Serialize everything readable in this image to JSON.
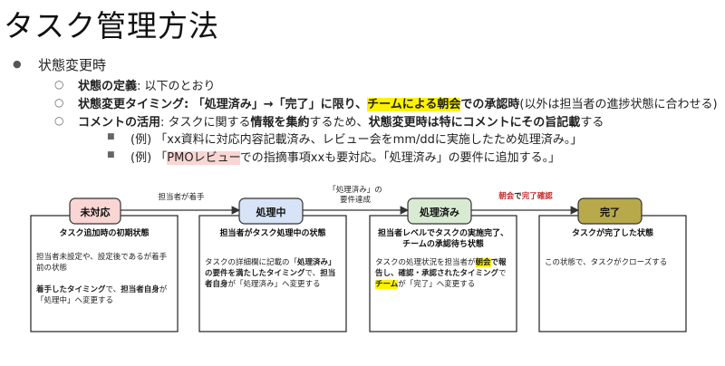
{
  "title": "タスク管理方法",
  "section": {
    "bullet": "●",
    "heading": "状態変更時"
  },
  "items": [
    {
      "bullet": "○",
      "label": "状態の定義",
      "text": ": 以下のとおり"
    },
    {
      "bullet": "○",
      "label": "状態変更タイミング",
      "t1": ": 「処理済み」→「完了」に限り、",
      "hl": "チームによる朝会",
      "t2": "での承認時",
      "t3": "(以外は担当者の進捗状態に合わせる)"
    },
    {
      "bullet": "○",
      "label": "コメントの活用",
      "t1": ": タスクに関する",
      "b1": "情報を集約",
      "t2": "するため、",
      "b2": "状態変更時は特にコメントにその旨記載",
      "t3": "する"
    }
  ],
  "examples": [
    {
      "bullet": "■",
      "text": "(例) 「xx資料に対応内容記載済み、レビュー会をmm/ddに実施したため処理済み。」"
    },
    {
      "bullet": "■",
      "pre": "(例) 「",
      "pink": "PMOレビュー",
      "post": "での指摘事項xxも要対応。「処理済み」の要件に追加する。」"
    }
  ],
  "flow": {
    "stages": [
      {
        "label": "未対応",
        "color": "#f9d5d3"
      },
      {
        "label": "処理中",
        "color": "#d7e3f7"
      },
      {
        "label": "処理済み",
        "color": "#d9ead3"
      },
      {
        "label": "完了",
        "color": "#b8a94a"
      }
    ],
    "arrows": [
      {
        "label": "担当者が着手"
      },
      {
        "label1": "「処理済み」の",
        "label2": "要件達成"
      },
      {
        "red1": "朝会",
        "black": "で",
        "red2": "完了確認"
      }
    ],
    "boxes": [
      {
        "title": "タスク追加時の初期状態",
        "p1": "担当者未設定や、設定後であるが着手前の状態",
        "b1": "着手したタイミング",
        "m1": "で、",
        "b2": "担当者自身",
        "m2": "が「処理中」へ変更する"
      },
      {
        "title": "担当者がタスク処理中の状態",
        "t1": "タスクの詳細欄に記載の「",
        "b1": "処理済み」の要件を満たしたタイミング",
        "t2": "で、",
        "b2": "担当者自身",
        "t3": "が「処理済み」へ変更する"
      },
      {
        "title1": "担当者レベルでタスクの実施完了、",
        "title2": "チームの承認待ち状態",
        "t1": "タスクの処理状況を担当者が",
        "hl1": "朝会",
        "b1": "で報告し、確認・承認されたタイミング",
        "t2": "で",
        "hl2": "チーム",
        "t3": "が「完了」へ変更する"
      },
      {
        "title": "タスクが完了した状態",
        "text": "この状態で、タスクがクローズする"
      }
    ]
  }
}
